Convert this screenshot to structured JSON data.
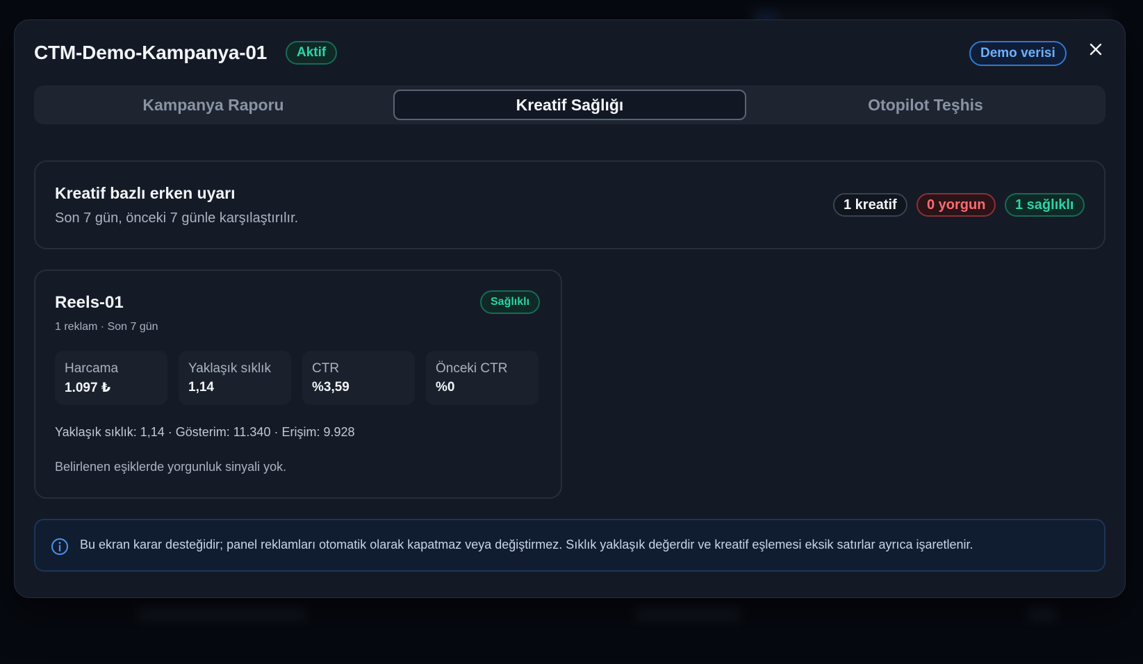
{
  "modal": {
    "title": "CTM-Demo-Kampanya-01",
    "status": "Aktif",
    "demo_label": "Demo verisi",
    "close_icon": "close-icon"
  },
  "tabs": [
    {
      "label": "Kampanya Raporu",
      "active": false
    },
    {
      "label": "Kreatif Sağlığı",
      "active": true
    },
    {
      "label": "Otopilot Teşhis",
      "active": false
    }
  ],
  "summary": {
    "title": "Kreatif bazlı erken uyarı",
    "subtitle": "Son 7 gün, önceki 7 günle karşılaştırılır.",
    "badges": {
      "count": "1 kreatif",
      "tired": "0 yorgun",
      "healthy": "1 sağlıklı"
    }
  },
  "creative": {
    "name": "Reels-01",
    "meta": "1 reklam · Son 7 gün",
    "status": "Sağlıklı",
    "metrics": [
      {
        "label": "Harcama",
        "value": "1.097 ₺"
      },
      {
        "label": "Yaklaşık sıklık",
        "value": "1,14"
      },
      {
        "label": "CTR",
        "value": "%3,59"
      },
      {
        "label": "Önceki CTR",
        "value": "%0"
      }
    ],
    "stats": "Yaklaşık sıklık: 1,14 · Gösterim: 11.340 · Erişim: 9.928",
    "note": "Belirlenen eşiklerde yorgunluk sinyali yok."
  },
  "info": {
    "icon": "info-icon",
    "text": "Bu ekran karar desteğidir; panel reklamları otomatik olarak kapatmaz veya değiştirmez. Sıklık yaklaşık değerdir ve kreatif eşlemesi eksik satırlar ayrıca işaretlenir."
  },
  "colors": {
    "accent_green": "#2dd4a6",
    "accent_red": "#ff6b72",
    "accent_blue": "#6fb0ff",
    "modal_bg": "#141a25"
  }
}
